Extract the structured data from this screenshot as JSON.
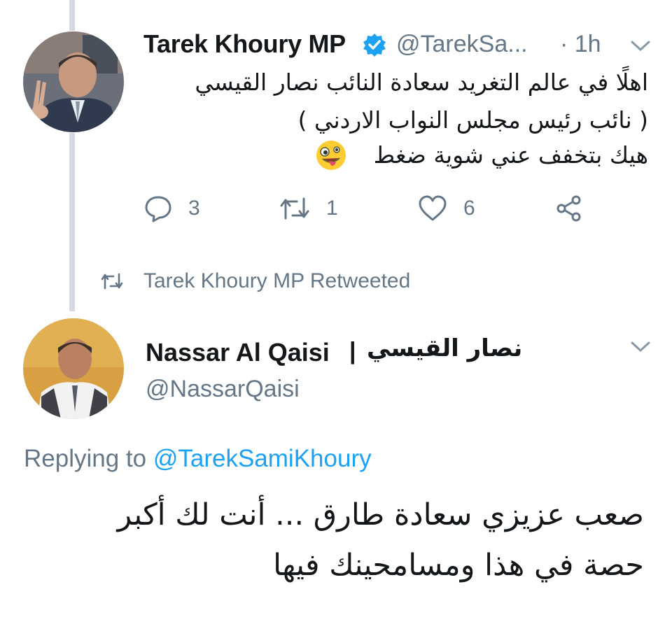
{
  "tweet1": {
    "author_name": "Tarek Khoury MP",
    "handle": "@TarekSa...",
    "time": "· 1h",
    "verified_icon": "verified-badge-icon",
    "text_lines": [
      "اهلًا في عالم التغريد سعادة النائب نصار القيسي",
      "( نائب رئيس مجلس النواب الاردني )",
      "هيك بتخفف عني شوية ضغط"
    ],
    "emoji": "zany-face-emoji",
    "actions": {
      "replies": "3",
      "retweets": "1",
      "likes": "6"
    }
  },
  "retweet_notice": "Tarek Khoury MP Retweeted",
  "tweet2": {
    "author_name": "Nassar Al Qaisi",
    "separator": "|",
    "author_name_ar": "نصار القيسي",
    "handle": "@NassarQaisi",
    "replying_prefix": "Replying to",
    "replying_to": "@TarekSamiKhoury",
    "text_lines": [
      "صعب عزيزي سعادة طارق ... أنت لك أكبر",
      "حصة في هذا ومسامحينك فيها"
    ]
  },
  "colors": {
    "text": "#14171a",
    "secondary": "#657786",
    "link": "#1da1f2",
    "thread_line": "#d4dae0"
  }
}
